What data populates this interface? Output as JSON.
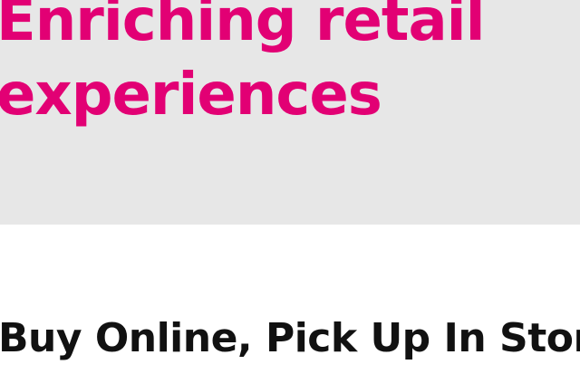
{
  "hero": {
    "title_line1": "Enriching retail",
    "title_line2": "experiences",
    "background_color": "#e7e7e7",
    "title_color": "#e20074"
  },
  "section": {
    "heading": "Buy Online, Pick Up In Stor",
    "heading_color": "#111111"
  }
}
